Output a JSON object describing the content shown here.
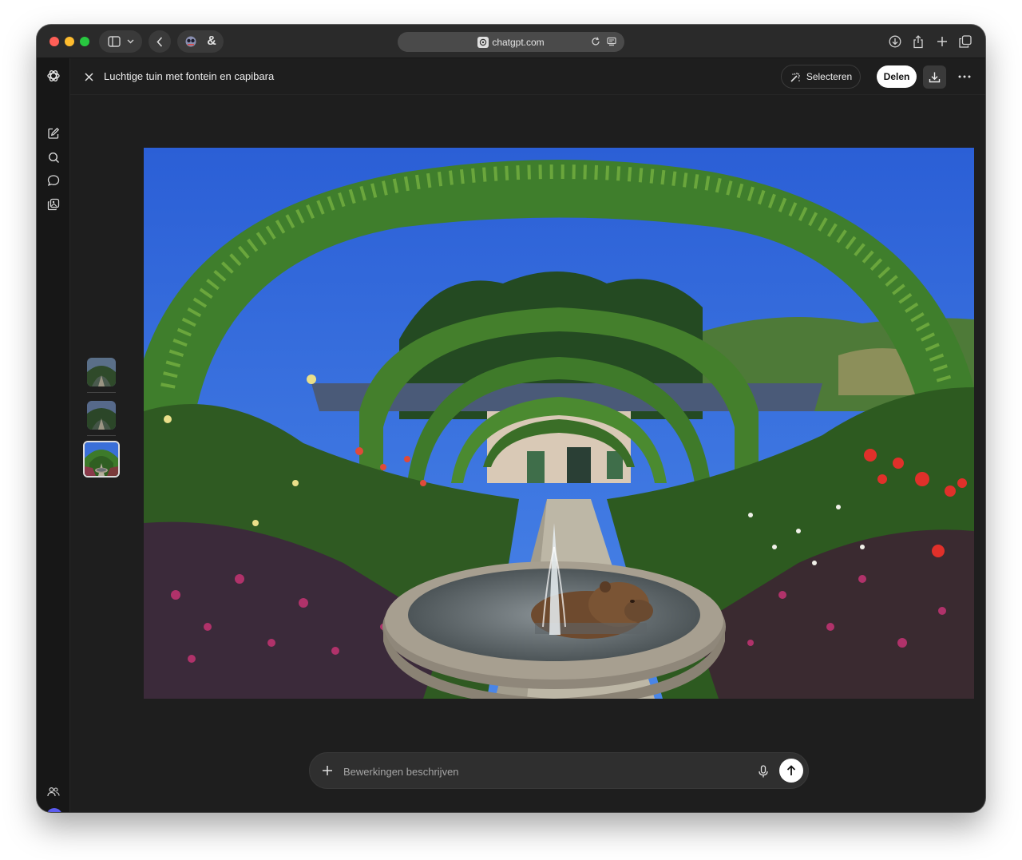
{
  "browser": {
    "url": "chatgpt.com"
  },
  "header": {
    "title": "Luchtige tuin met fontein en capibara",
    "select_label": "Selecteren",
    "share_label": "Delen"
  },
  "composer": {
    "placeholder": "Bewerkingen beschrijven"
  },
  "thumbnails": {
    "count": 3,
    "active_index": 2
  },
  "colors": {
    "app_background": "#1e1e1e",
    "sidebar_background": "#171717",
    "accent_badge": "#5b5bf0"
  },
  "icons": {
    "sidebar": [
      "openai-logo-icon",
      "new-chat-icon",
      "search-icon",
      "chat-icon",
      "library-icon"
    ],
    "sidebar_bottom": [
      "team-icon",
      "plan-badge-icon"
    ],
    "browser_left": [
      "sidebar-toggle-icon",
      "chevron-down-icon",
      "back-arrow-icon",
      "extension-icon",
      "ampersand-icon"
    ],
    "browser_right": [
      "downloads-icon",
      "share-icon",
      "new-tab-icon",
      "tabs-overview-icon"
    ]
  }
}
